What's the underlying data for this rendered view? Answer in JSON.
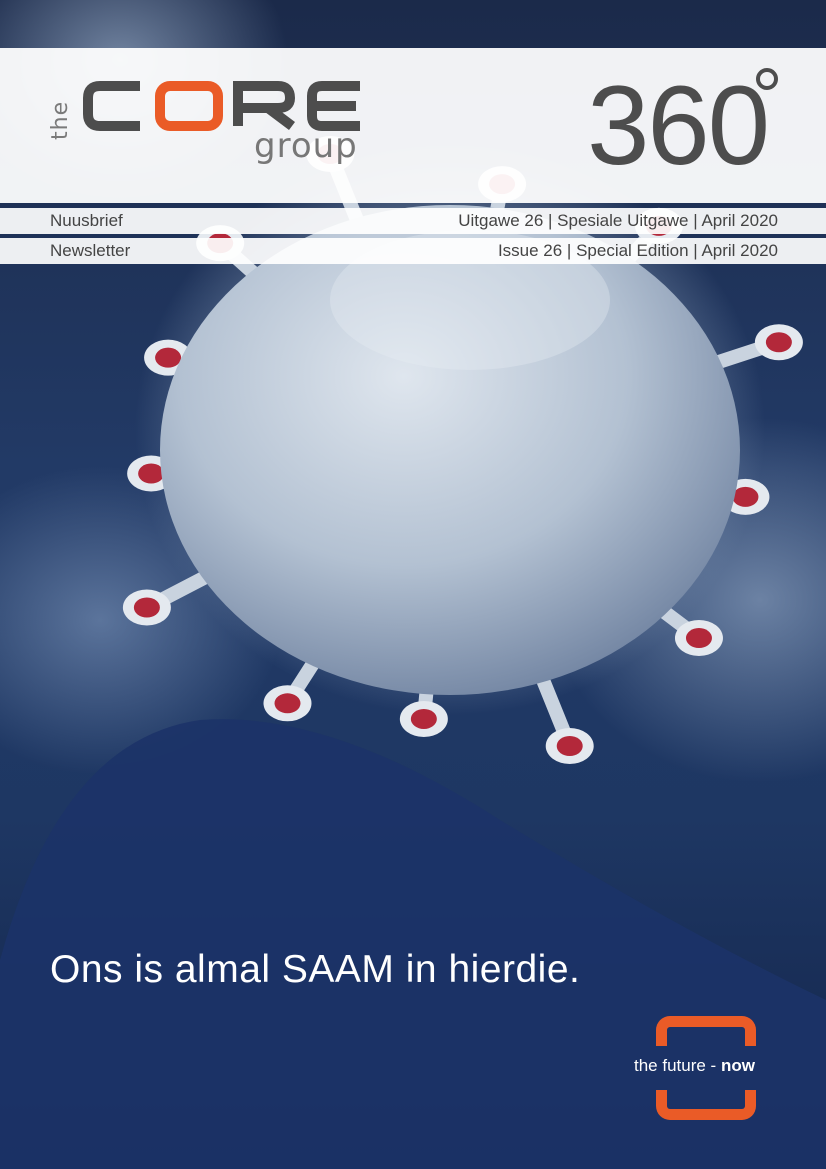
{
  "brand": {
    "logo_the": "the",
    "logo_core": "CORE",
    "logo_group": "group",
    "issue_number": "360",
    "colors": {
      "accent": "#ea5b27",
      "logo_gray": "#4d4d4d",
      "swoosh": "#1c3368"
    }
  },
  "info_afrikaans": {
    "left": "Nuusbrief",
    "right": "Uitgawe 26  |  Spesiale Uitgawe  |  April 2020"
  },
  "info_english": {
    "left": "Newsletter",
    "right": "Issue 26  | Special Edition  |  April 2020"
  },
  "headline": "Ons is almal SAAM in hierdie.",
  "footer_logo": {
    "tagline_prefix": "the future - ",
    "tagline_bold": "now"
  }
}
